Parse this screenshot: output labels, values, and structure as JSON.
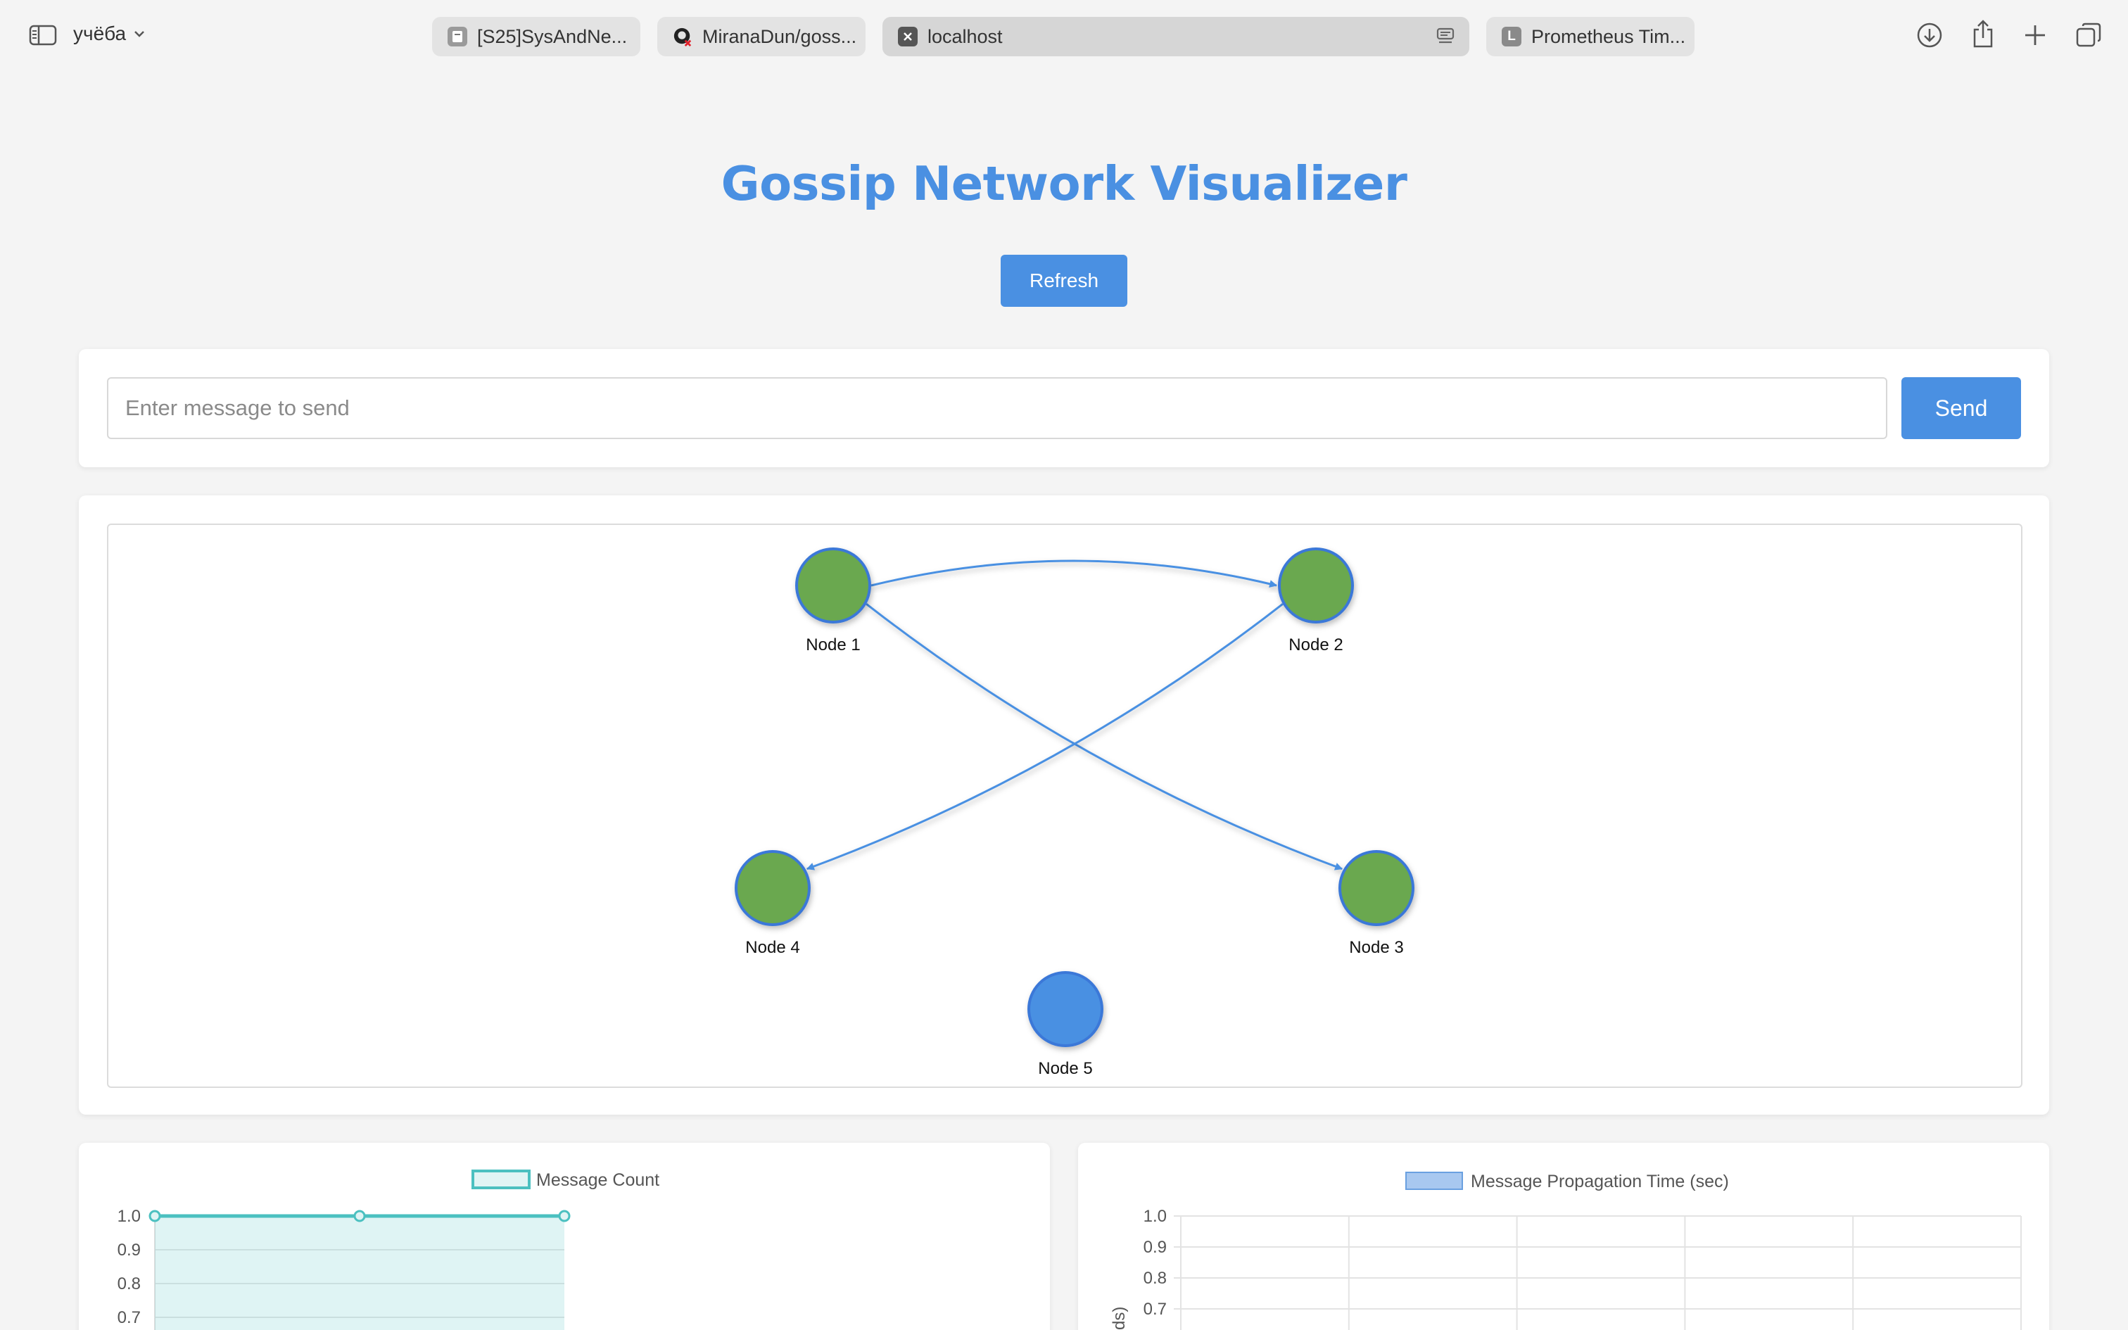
{
  "browser": {
    "profile_name": "учёба",
    "tabs": [
      {
        "label": "[S25]SysAndNe...",
        "favicon": "book-favicon",
        "active": false
      },
      {
        "label": "MiranaDun/goss...",
        "favicon": "github-favicon",
        "active": false
      },
      {
        "label": "localhost",
        "favicon": "close-favicon",
        "active": true
      },
      {
        "label": "Prometheus Tim...",
        "favicon": "L",
        "active": false
      }
    ],
    "icons": [
      "sidebar-icon",
      "chevron-down-icon",
      "reader-icon",
      "download-icon",
      "share-icon",
      "new-tab-icon",
      "tab-overview-icon"
    ]
  },
  "page": {
    "title": "Gossip Network Visualizer",
    "refresh_label": "Refresh",
    "message_placeholder": "Enter message to send",
    "message_value": "",
    "send_label": "Send"
  },
  "graph": {
    "nodes": [
      {
        "id": 1,
        "label": "Node 1",
        "color": "#6aa84f"
      },
      {
        "id": 2,
        "label": "Node 2",
        "color": "#6aa84f"
      },
      {
        "id": 3,
        "label": "Node 3",
        "color": "#6aa84f"
      },
      {
        "id": 4,
        "label": "Node 4",
        "color": "#6aa84f"
      },
      {
        "id": 5,
        "label": "Node 5",
        "color": "#4a90e2"
      }
    ],
    "edges": [
      {
        "from": 1,
        "to": 2
      },
      {
        "from": 1,
        "to": 3
      },
      {
        "from": 2,
        "to": 4
      }
    ],
    "edge_color": "#4a90e2",
    "node_border_color": "#3b78d8"
  },
  "chart_data": [
    {
      "type": "line",
      "legend": [
        "Message Count"
      ],
      "series": [
        {
          "name": "Message Count",
          "values": [
            1.0,
            1.0,
            1.0
          ]
        }
      ],
      "y_ticks_visible": [
        "1.0",
        "0.9",
        "0.8",
        "0.7"
      ],
      "color": "#4bc0c0",
      "grid": true,
      "legend_position": "top"
    },
    {
      "type": "bar",
      "legend": [
        "Message Propagation Time (sec)"
      ],
      "series": [
        {
          "name": "Message Propagation Time (sec)",
          "values": []
        }
      ],
      "y_ticks_visible": [
        "1.0",
        "0.9",
        "0.8",
        "0.7"
      ],
      "color": "#a8c8f0",
      "grid": true,
      "legend_position": "top"
    }
  ]
}
